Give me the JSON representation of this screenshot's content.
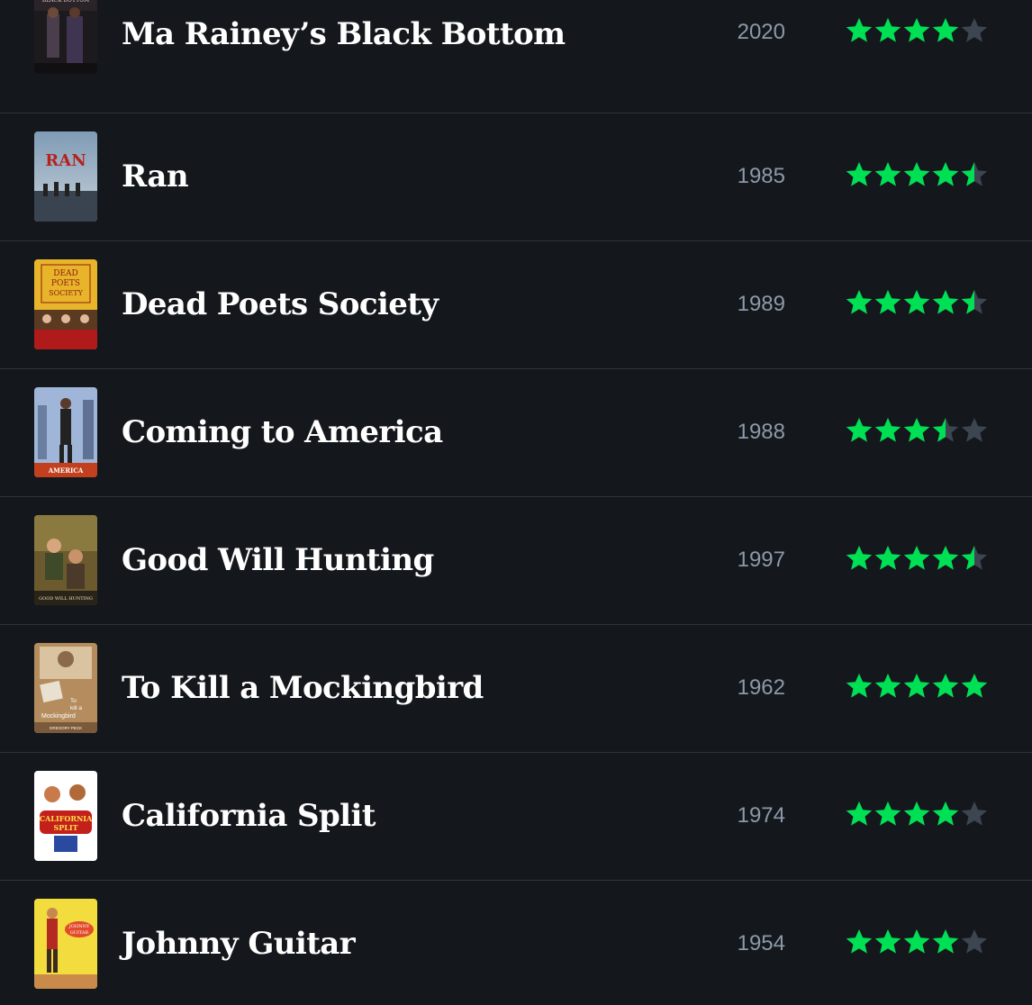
{
  "colors": {
    "background": "#14181c",
    "divider": "#2c3440",
    "title": "#ffffff",
    "year": "#8c99a8",
    "star_on": "#00e054",
    "star_off": "#3d4550"
  },
  "films": [
    {
      "title": "Ma Rainey’s Black Bottom",
      "year": "2020",
      "rating": 4,
      "poster_text": "MA RAINEY'S BLACK BOTTOM"
    },
    {
      "title": "Ran",
      "year": "1985",
      "rating": 4.5,
      "poster_text": "RAN"
    },
    {
      "title": "Dead Poets Society",
      "year": "1989",
      "rating": 4.5,
      "poster_text": "DEAD POETS SOCIETY"
    },
    {
      "title": "Coming to America",
      "year": "1988",
      "rating": 3.5,
      "poster_text": "AMERICA"
    },
    {
      "title": "Good Will Hunting",
      "year": "1997",
      "rating": 4.5,
      "poster_text": "GOOD WILL HUNTING"
    },
    {
      "title": "To Kill a Mockingbird",
      "year": "1962",
      "rating": 5,
      "poster_text": "To kill a Mockingbird GREGORY PECK"
    },
    {
      "title": "California Split",
      "year": "1974",
      "rating": 4,
      "poster_text": "CALIFORNIA SPLIT"
    },
    {
      "title": "Johnny Guitar",
      "year": "1954",
      "rating": 4,
      "poster_text": "JOHNNY GUITAR"
    }
  ]
}
